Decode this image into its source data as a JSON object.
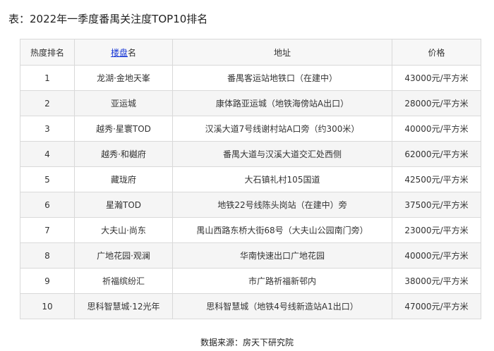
{
  "caption": "表：2022年一季度番禺关注度TOP10排名",
  "table": {
    "headers": {
      "rank": "热度排名",
      "name_link": "楼盘",
      "name_rest": "名",
      "address": "地址",
      "price": "价格"
    },
    "rows": [
      {
        "rank": "1",
        "name": "龙湖·金地天峯",
        "address": "番禺客运站地铁口（在建中）",
        "price": "43000元/平方米"
      },
      {
        "rank": "2",
        "name": "亚运城",
        "address": "康体路亚运城（地铁海傍站A出口）",
        "price": "28000元/平方米"
      },
      {
        "rank": "3",
        "name": "越秀·星寰TOD",
        "address": "汉溪大道7号线谢村站A口旁（约300米）",
        "price": "40000元/平方米"
      },
      {
        "rank": "4",
        "name": "越秀·和樾府",
        "address": "番禺大道与汉溪大道交汇处西侧",
        "price": "62000元/平方米"
      },
      {
        "rank": "5",
        "name": "藏珑府",
        "address": "大石镇礼村105国道",
        "price": "42500元/平方米"
      },
      {
        "rank": "6",
        "name": "星瀚TOD",
        "address": "地铁22号线陈头岗站（在建中）旁",
        "price": "37500元/平方米"
      },
      {
        "rank": "7",
        "name": "大夫山·尚东",
        "address": "禺山西路东桥大街68号（大夫山公园南门旁）",
        "price": "23000元/平方米"
      },
      {
        "rank": "8",
        "name": "广地花园·观澜",
        "address": "华南快速出口广地花园",
        "price": "40000元/平方米"
      },
      {
        "rank": "9",
        "name": "祈福缤纷汇",
        "address": "市广路祈福新邨内",
        "price": "38000元/平方米"
      },
      {
        "rank": "10",
        "name": "思科智慧城·12光年",
        "address": "思科智慧城（地铁4号线新造站A1出口）",
        "price": "47000元/平方米"
      }
    ]
  },
  "source": "数据来源：房天下研究院"
}
